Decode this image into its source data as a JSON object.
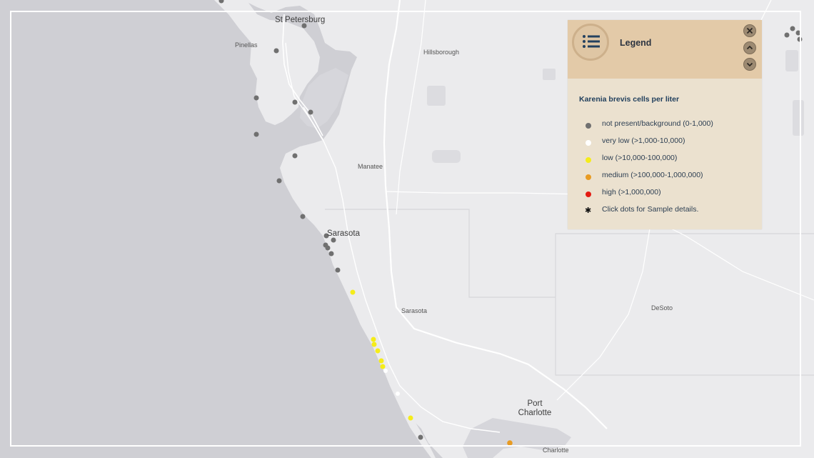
{
  "map": {
    "labels": {
      "st_petersburg": "St Petersburg",
      "pinellas": "Pinellas",
      "hillsborough": "Hillsborough",
      "manatee": "Manatee",
      "sarasota_city": "Sarasota",
      "sarasota_county": "Sarasota",
      "desoto": "DeSoto",
      "port_charlotte_line1": "Port",
      "port_charlotte_line2": "Charlotte",
      "charlotte": "Charlotte"
    },
    "colors": {
      "water": "#cfcfd4",
      "land": "#ebebed",
      "not_present": "#707070",
      "very_low": "#ffffff",
      "low": "#f5ec1a",
      "medium": "#e89b22",
      "high": "#e31b12"
    }
  },
  "legend": {
    "title": "Legend",
    "icon": "list-icon",
    "controls": [
      "close-icon",
      "chevron-up-icon",
      "chevron-down-icon"
    ],
    "subtitle": "Karenia brevis cells per liter",
    "items": [
      {
        "label": "not present/background (0-1,000)",
        "color": "#707070"
      },
      {
        "label": "very low (>1,000-10,000)",
        "color": "#ffffff"
      },
      {
        "label": "low (>10,000-100,000)",
        "color": "#f5ec1a"
      },
      {
        "label": "medium (>100,000-1,000,000)",
        "color": "#e89b22"
      },
      {
        "label": "high (>1,000,000)",
        "color": "#e31b12"
      },
      {
        "label": "Click dots for Sample details.",
        "icon": "asterisk-icon"
      }
    ]
  }
}
